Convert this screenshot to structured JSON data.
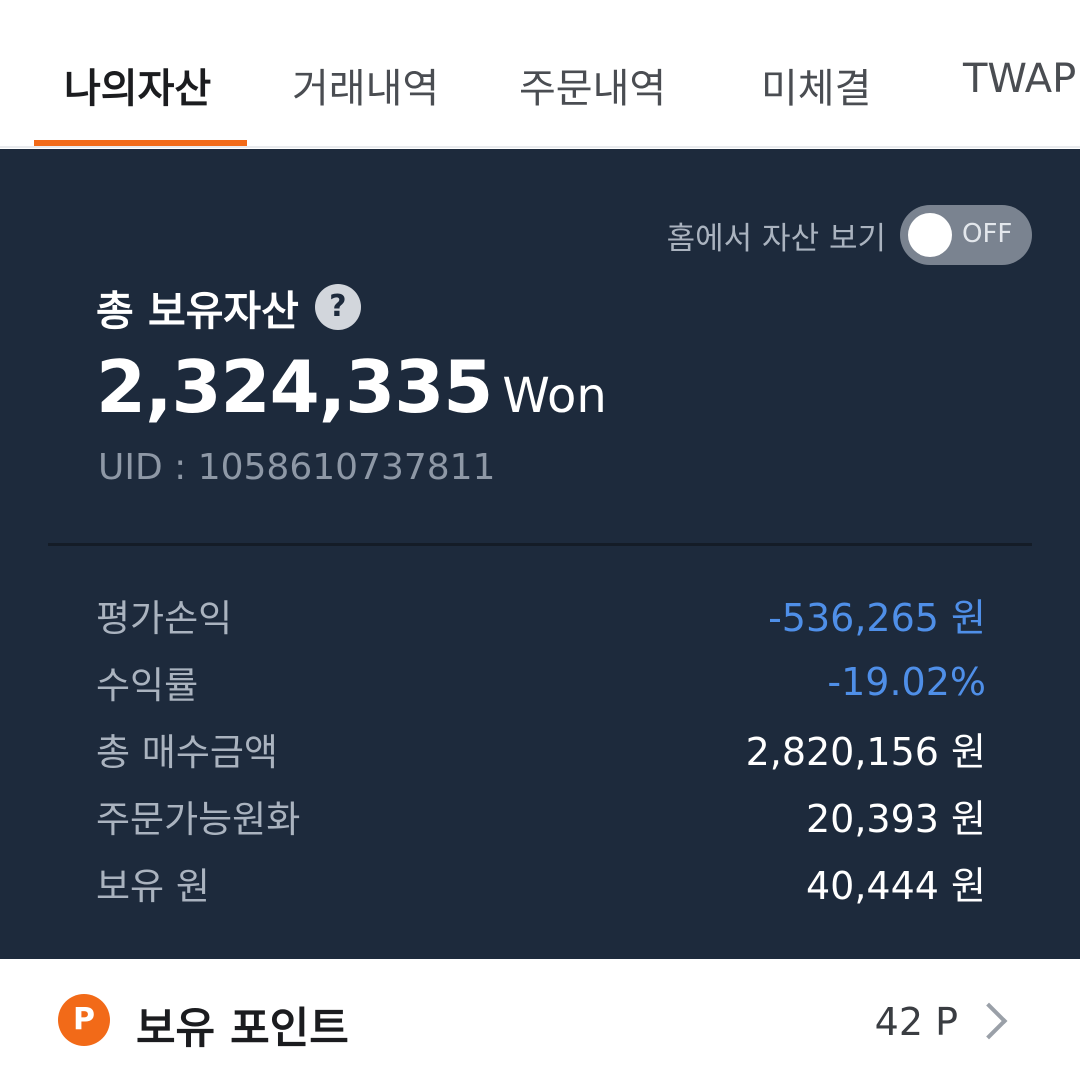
{
  "tabs": [
    {
      "label": "나의자산",
      "active": true
    },
    {
      "label": "거래내역",
      "active": false
    },
    {
      "label": "주문내역",
      "active": false
    },
    {
      "label": "미체결",
      "active": false
    },
    {
      "label": "TWAP",
      "active": false
    }
  ],
  "toggle": {
    "label": "홈에서 자산 보기",
    "state": "OFF"
  },
  "total": {
    "label": "총 보유자산",
    "help_icon": "question-icon",
    "value": "2,324,335",
    "unit": "Won",
    "uid": "UID : 1058610737811"
  },
  "stats": [
    {
      "label": "평가손익",
      "value": "-536,265 원",
      "negative": true
    },
    {
      "label": "수익률",
      "value": "-19.02%",
      "negative": true
    },
    {
      "label": "총 매수금액",
      "value": "2,820,156 원",
      "negative": false
    },
    {
      "label": "주문가능원화",
      "value": "20,393 원",
      "negative": false
    },
    {
      "label": "보유 원",
      "value": "40,444 원",
      "negative": false
    }
  ],
  "points": {
    "icon_letter": "P",
    "label": "보유 포인트",
    "value": "42 P"
  },
  "colors": {
    "accent": "#f26a18",
    "panel": "#1d2a3c",
    "negative": "#4f8fe8"
  }
}
